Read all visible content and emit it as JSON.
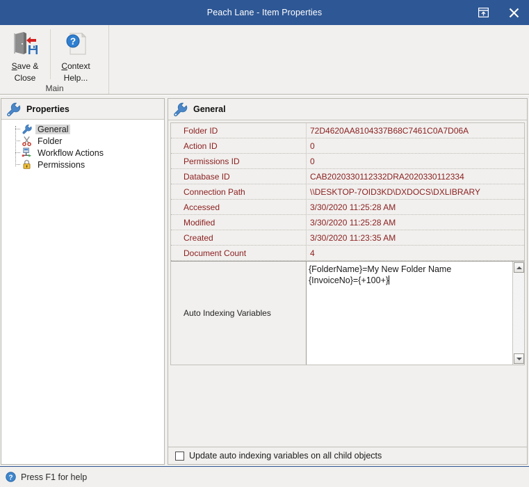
{
  "window": {
    "title": "Peach Lane - Item Properties",
    "popout_icon": "popout-window-icon",
    "close_icon": "close-icon"
  },
  "ribbon": {
    "group_title": "Main",
    "buttons": [
      {
        "id": "save-close",
        "icon": "save-and-close-icon",
        "line1": "Save &",
        "line2": "Close",
        "accel": "S"
      },
      {
        "id": "context-help",
        "icon": "context-help-icon",
        "line1": "Context",
        "line2": "Help...",
        "accel": "C"
      }
    ]
  },
  "sidebar": {
    "header": "Properties",
    "header_icon": "wrench-icon",
    "items": [
      {
        "label": "General",
        "icon": "wrench-icon",
        "selected": true
      },
      {
        "label": "Folder",
        "icon": "scissors-icon",
        "selected": false
      },
      {
        "label": "Workflow Actions",
        "icon": "workflow-icon",
        "selected": false
      },
      {
        "label": "Permissions",
        "icon": "padlock-icon",
        "selected": false
      }
    ]
  },
  "content": {
    "header": "General",
    "header_icon": "wrench-icon",
    "properties": [
      {
        "name": "Folder ID",
        "value": "72D4620AA8104337B68C7461C0A7D06A"
      },
      {
        "name": "Action ID",
        "value": "0"
      },
      {
        "name": "Permissions ID",
        "value": "0"
      },
      {
        "name": "Database ID",
        "value": "CAB2020330112332DRA2020330112334"
      },
      {
        "name": "Connection Path",
        "value": "\\\\DESKTOP-7OID3KD\\DXDOCS\\DXLIBRARY"
      },
      {
        "name": "Accessed",
        "value": "3/30/2020 11:25:28 AM"
      },
      {
        "name": "Modified",
        "value": "3/30/2020 11:25:28 AM"
      },
      {
        "name": "Created",
        "value": "3/30/2020 11:23:35 AM"
      },
      {
        "name": "Document Count",
        "value": "4"
      }
    ],
    "editor": {
      "name": "Auto Indexing Variables",
      "value": "{FolderName}=My New Folder Name\n{InvoiceNo}={+100+}",
      "scrollbar_up_icon": "scroll-up-arrow-icon",
      "scrollbar_down_icon": "scroll-down-arrow-icon"
    },
    "checkbox": {
      "label": "Update auto indexing variables on all child objects",
      "checked": false
    }
  },
  "statusbar": {
    "icon": "help-info-icon",
    "text": "Press F1 for help"
  },
  "colors": {
    "titlebar": "#2e5795",
    "chrome": "#f1f0ee",
    "property_text": "#8b2020",
    "accent": "#2e5795"
  }
}
